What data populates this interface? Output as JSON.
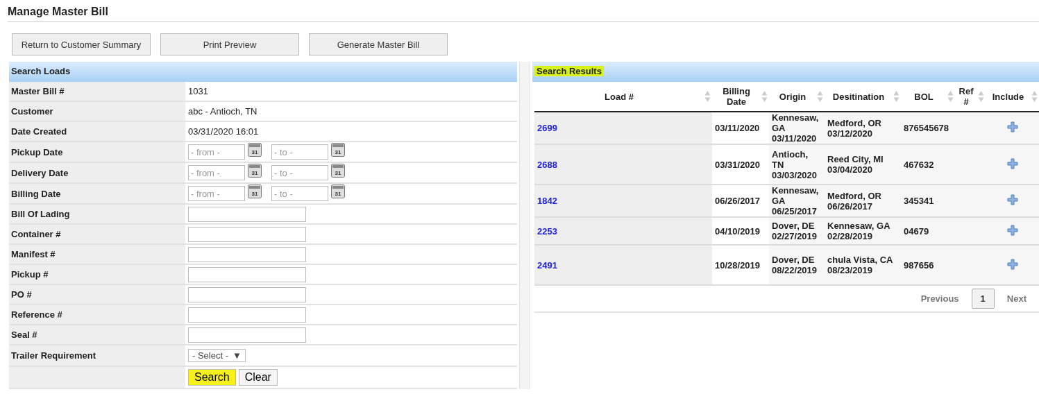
{
  "page": {
    "title": "Manage Master Bill"
  },
  "toolbar": [
    {
      "label": "Return to Customer Summary"
    },
    {
      "label": "Print Preview"
    },
    {
      "label": "Generate Master Bill"
    }
  ],
  "search_loads": {
    "title": "Search Loads",
    "fields": [
      {
        "kind": "text",
        "label": "Master Bill #",
        "value": "1031"
      },
      {
        "kind": "text",
        "label": "Customer",
        "value": "abc - Antioch, TN"
      },
      {
        "kind": "text",
        "label": "Date Created",
        "value": "03/31/2020 16:01"
      },
      {
        "kind": "daterange",
        "label": "Pickup Date",
        "from_placeholder": "- from -",
        "from_calendar": "31",
        "to_placeholder": "- to -",
        "to_calendar": "31"
      },
      {
        "kind": "daterange",
        "label": "Delivery Date",
        "from_placeholder": "- from -",
        "from_calendar": "31",
        "to_placeholder": "- to -",
        "to_calendar": "31"
      },
      {
        "kind": "daterange",
        "label": "Billing Date",
        "from_placeholder": "- from -",
        "from_calendar": "31",
        "to_placeholder": "- to -",
        "to_calendar": "31"
      },
      {
        "kind": "input",
        "label": "Bill Of Lading"
      },
      {
        "kind": "input",
        "label": "Container #"
      },
      {
        "kind": "input",
        "label": "Manifest #"
      },
      {
        "kind": "input",
        "label": "Pickup #"
      },
      {
        "kind": "input",
        "label": "PO #"
      },
      {
        "kind": "input",
        "label": "Reference #"
      },
      {
        "kind": "input",
        "label": "Seal #"
      },
      {
        "kind": "select",
        "label": "Trailer Requirement",
        "value": "- Select -",
        "arrow": "▼"
      }
    ],
    "buttons": [
      {
        "label": "Search",
        "highlighted": true
      },
      {
        "label": "Clear",
        "highlighted": false
      }
    ]
  },
  "search_results": {
    "title": "Search Results",
    "title_highlighted": true,
    "columns": [
      "Load #",
      "Billing Date",
      "Origin",
      "Desitination",
      "BOL",
      "Ref #",
      "Include"
    ],
    "rows": [
      {
        "load": "2699",
        "billing_date": "03/11/2020",
        "origin": "Kennesaw, GA",
        "origin_date": "03/11/2020",
        "destination": "Medford, OR",
        "destination_date": "03/12/2020",
        "bol": "876545678"
      },
      {
        "load": "2688",
        "billing_date": "03/31/2020",
        "origin": "Antioch, TN",
        "origin_date": "03/03/2020",
        "destination": "Reed City, MI",
        "destination_date": "03/04/2020",
        "bol": "467632"
      },
      {
        "load": "1842",
        "billing_date": "06/26/2017",
        "origin": "Kennesaw, GA",
        "origin_date": "06/25/2017",
        "destination": "Medford, OR",
        "destination_date": "06/26/2017",
        "bol": "345341"
      },
      {
        "load": "2253",
        "billing_date": "04/10/2019",
        "origin": "Dover, DE",
        "origin_date": "02/27/2019",
        "destination": "Kennesaw, GA",
        "destination_date": "02/28/2019",
        "bol": "04679"
      },
      {
        "load": "2491",
        "billing_date": "10/28/2019",
        "origin": "Dover, DE",
        "origin_date": "08/22/2019",
        "destination": "chula Vista, CA",
        "destination_date": "08/23/2019",
        "bol": "987656"
      }
    ],
    "pager": [
      {
        "label": "Previous",
        "selected": false
      },
      {
        "label": "1",
        "selected": true
      },
      {
        "label": "Next",
        "selected": false
      }
    ]
  }
}
